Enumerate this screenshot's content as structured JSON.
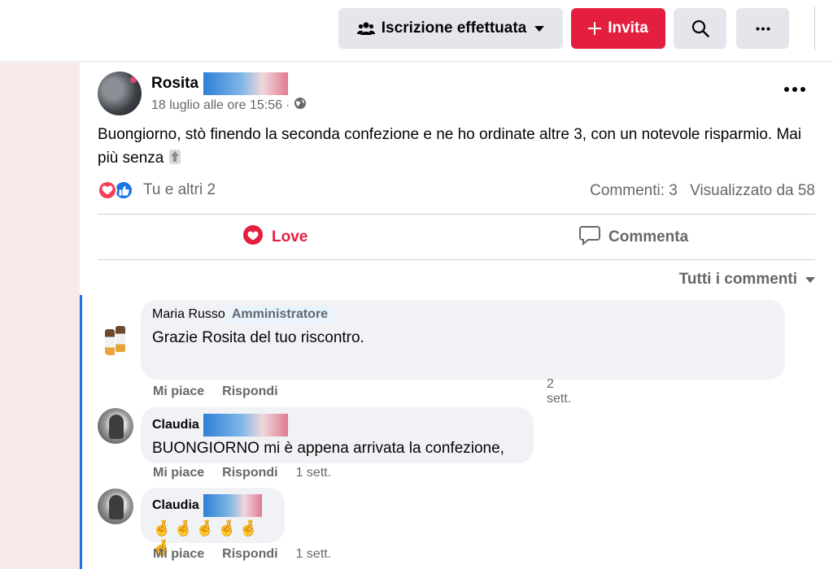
{
  "header": {
    "joined_label": "Iscrizione effettuata",
    "invite_label": "Invita",
    "icons": {
      "members": "people-group-icon",
      "invite": "plus-icon",
      "search": "search-icon",
      "more": "more-horizontal-icon",
      "caret": "caret-down-icon"
    },
    "invite_color": "#e41e3f"
  },
  "post": {
    "author": "Rosita",
    "date": "18 luglio alle ore 15:56",
    "audience_icon": "public-globe-icon",
    "text": "Buongiorno,  stò finendo la seconda confezione e ne ho ordinate altre 3, con un notevole risparmio.  Mai più senza",
    "reactions_text": "Tu e altri 2",
    "comments_count": "Commenti: 3",
    "views": "Visualizzato da 58",
    "love_label": "Love",
    "comment_label": "Commenta",
    "sort_label": "Tutti i commenti",
    "accent_color": "#1b74e4"
  },
  "comments": [
    {
      "author": "Maria Russo",
      "badge": "Amministratore",
      "text": "Grazie Rosita del tuo riscontro.",
      "like_label": "Mi piace",
      "reply_label": "Rispondi",
      "time": "2 sett."
    },
    {
      "author": "Claudia",
      "text": "BUONGIORNO mi è appena arrivata la confezione,",
      "like_label": "Mi piace",
      "reply_label": "Rispondi",
      "time": "1 sett."
    },
    {
      "author": "Claudia",
      "text": "🤞🤞🤞🤞🤞🤞",
      "like_label": "Mi piace",
      "reply_label": "Rispondi",
      "time": "1 sett."
    }
  ]
}
